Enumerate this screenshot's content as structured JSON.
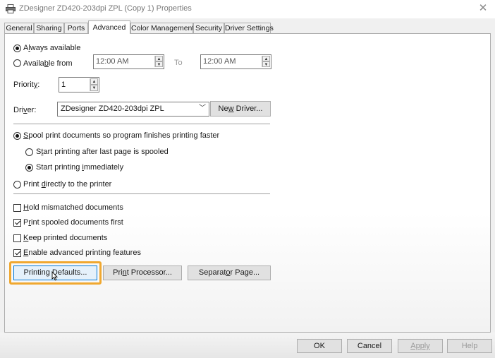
{
  "window": {
    "title": "ZDesigner ZD420-203dpi ZPL (Copy 1) Properties",
    "close_glyph": "✕"
  },
  "tabs": [
    "General",
    "Sharing",
    "Ports",
    "Advanced",
    "Color Management",
    "Security",
    "Driver Settings"
  ],
  "active_tab": "Advanced",
  "availability": {
    "always_pre": "A",
    "always_u": "l",
    "always_post": "ways available",
    "from_pre": "Availa",
    "from_u": "b",
    "from_post": "le from",
    "from_time": "12:00 AM",
    "to_label": "To",
    "to_time": "12:00 AM",
    "selected": "always"
  },
  "priority": {
    "pre": "Priorit",
    "u": "y",
    "post": ":",
    "value": "1"
  },
  "driver": {
    "pre": "Dri",
    "u": "v",
    "post": "er:",
    "value": "ZDesigner ZD420-203dpi ZPL",
    "new_pre": "Ne",
    "new_u": "w",
    "new_post": " Driver..."
  },
  "spool": {
    "spool_u": "S",
    "spool_post": "pool print documents so program finishes printing faster",
    "after_pre": "S",
    "after_u": "t",
    "after_post": "art printing after last page is spooled",
    "imm_pre": "Start printing ",
    "imm_u": "i",
    "imm_post": "mmediately",
    "direct_pre": "Print ",
    "direct_u": "d",
    "direct_post": "irectly to the printer"
  },
  "options": {
    "hold_u": "H",
    "hold_post": "old mismatched documents",
    "hold_checked": false,
    "spooled_pre": "P",
    "spooled_u": "r",
    "spooled_post": "int spooled documents first",
    "spooled_checked": true,
    "keep_u": "K",
    "keep_post": "eep printed documents",
    "keep_checked": false,
    "enable_u": "E",
    "enable_post": "nable advanced printing features",
    "enable_checked": true
  },
  "buttons": {
    "defaults_pre": "Printin",
    "defaults_u": "g",
    "defaults_post": " Defaults...",
    "processor_pre": "Pri",
    "processor_u": "n",
    "processor_post": "t Processor...",
    "separator_pre": "Separat",
    "separator_u": "o",
    "separator_post": "r Page..."
  },
  "footer": {
    "ok": "OK",
    "cancel": "Cancel",
    "apply": "Apply",
    "help": "Help"
  },
  "colors": {
    "highlight": "#f0a830"
  }
}
